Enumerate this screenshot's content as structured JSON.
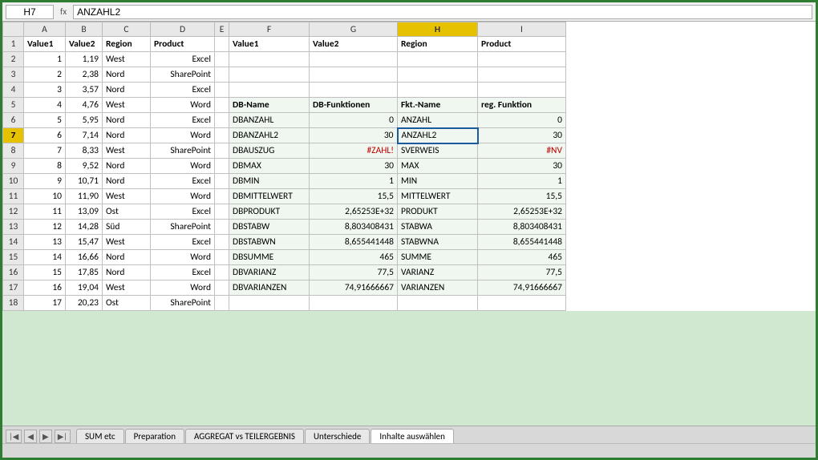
{
  "formulaBar": {
    "cellRef": "H7",
    "formula": "ANZAHL2"
  },
  "columns": {
    "headers": [
      "",
      "A",
      "B",
      "C",
      "D",
      "E",
      "F",
      "G",
      "H",
      "I"
    ]
  },
  "row1": {
    "a": "Value1",
    "b": "Value2",
    "c": "Region",
    "d": "Product",
    "e": "",
    "f": "Value1",
    "g": "Value2",
    "h": "Region",
    "i": "Product"
  },
  "rows": [
    {
      "num": 2,
      "a": "1",
      "b": "1,19",
      "c": "West",
      "d": "Excel",
      "f": "",
      "g": "",
      "h": "",
      "i": ""
    },
    {
      "num": 3,
      "a": "2",
      "b": "2,38",
      "c": "Nord",
      "d": "SharePoint",
      "f": "",
      "g": "",
      "h": "",
      "i": ""
    },
    {
      "num": 4,
      "a": "3",
      "b": "3,57",
      "c": "Nord",
      "d": "Excel",
      "f": "",
      "g": "",
      "h": "",
      "i": ""
    },
    {
      "num": 5,
      "a": "4",
      "b": "4,76",
      "c": "West",
      "d": "Word",
      "f": "DB-Name",
      "g": "DB-Funktionen",
      "h": "Fkt.-Name",
      "i": "reg. Funktion"
    },
    {
      "num": 6,
      "a": "5",
      "b": "5,95",
      "c": "Nord",
      "d": "Excel",
      "f": "DBANZAHL",
      "g": "0",
      "h": "ANZAHL",
      "i": "0"
    },
    {
      "num": 7,
      "a": "6",
      "b": "7,14",
      "c": "Nord",
      "d": "Word",
      "f": "DBANZAHL2",
      "g": "30",
      "h": "ANZAHL2",
      "i": "30"
    },
    {
      "num": 8,
      "a": "7",
      "b": "8,33",
      "c": "West",
      "d": "SharePoint",
      "f": "DBAUSZUG",
      "g": "#ZAHL!",
      "h": "SVERWEIS",
      "i": "#NV"
    },
    {
      "num": 9,
      "a": "8",
      "b": "9,52",
      "c": "Nord",
      "d": "Word",
      "f": "DBMAX",
      "g": "30",
      "h": "MAX",
      "i": "30"
    },
    {
      "num": 10,
      "a": "9",
      "b": "10,71",
      "c": "Nord",
      "d": "Excel",
      "f": "DBMIN",
      "g": "1",
      "h": "MIN",
      "i": "1"
    },
    {
      "num": 11,
      "a": "10",
      "b": "11,90",
      "c": "West",
      "d": "Word",
      "f": "DBMITTELWERT",
      "g": "15,5",
      "h": "MITTELWERT",
      "i": "15,5"
    },
    {
      "num": 12,
      "a": "11",
      "b": "13,09",
      "c": "Ost",
      "d": "Excel",
      "f": "DBPRODUKT",
      "g": "2,65253E+32",
      "h": "PRODUKT",
      "i": "2,65253E+32"
    },
    {
      "num": 13,
      "a": "12",
      "b": "14,28",
      "c": "Süd",
      "d": "SharePoint",
      "f": "DBSTABW",
      "g": "8,803408431",
      "h": "STABWA",
      "i": "8,803408431"
    },
    {
      "num": 14,
      "a": "13",
      "b": "15,47",
      "c": "West",
      "d": "Excel",
      "f": "DBSTABWN",
      "g": "8,655441448",
      "h": "STABWNA",
      "i": "8,655441448"
    },
    {
      "num": 15,
      "a": "14",
      "b": "16,66",
      "c": "Nord",
      "d": "Word",
      "f": "DBSUMME",
      "g": "465",
      "h": "SUMME",
      "i": "465"
    },
    {
      "num": 16,
      "a": "15",
      "b": "17,85",
      "c": "Nord",
      "d": "Excel",
      "f": "DBVARIANZ",
      "g": "77,5",
      "h": "VARIANZ",
      "i": "77,5"
    },
    {
      "num": 17,
      "a": "16",
      "b": "19,04",
      "c": "West",
      "d": "Word",
      "f": "DBVARIANZEN",
      "g": "74,91666667",
      "h": "VARIANZEN",
      "i": "74,91666667"
    },
    {
      "num": 18,
      "a": "17",
      "b": "20,23",
      "c": "Ost",
      "d": "SharePoint",
      "f": "",
      "g": "",
      "h": "",
      "i": ""
    }
  ],
  "tabs": [
    {
      "label": "SUM etc",
      "active": false
    },
    {
      "label": "Preparation",
      "active": false
    },
    {
      "label": "AGGREGAT vs TEILERGEBNIS",
      "active": false
    },
    {
      "label": "Unterschiede",
      "active": false
    },
    {
      "label": "Inhalte auswählen",
      "active": true
    }
  ],
  "statusBar": {
    "left": "",
    "right": ""
  }
}
